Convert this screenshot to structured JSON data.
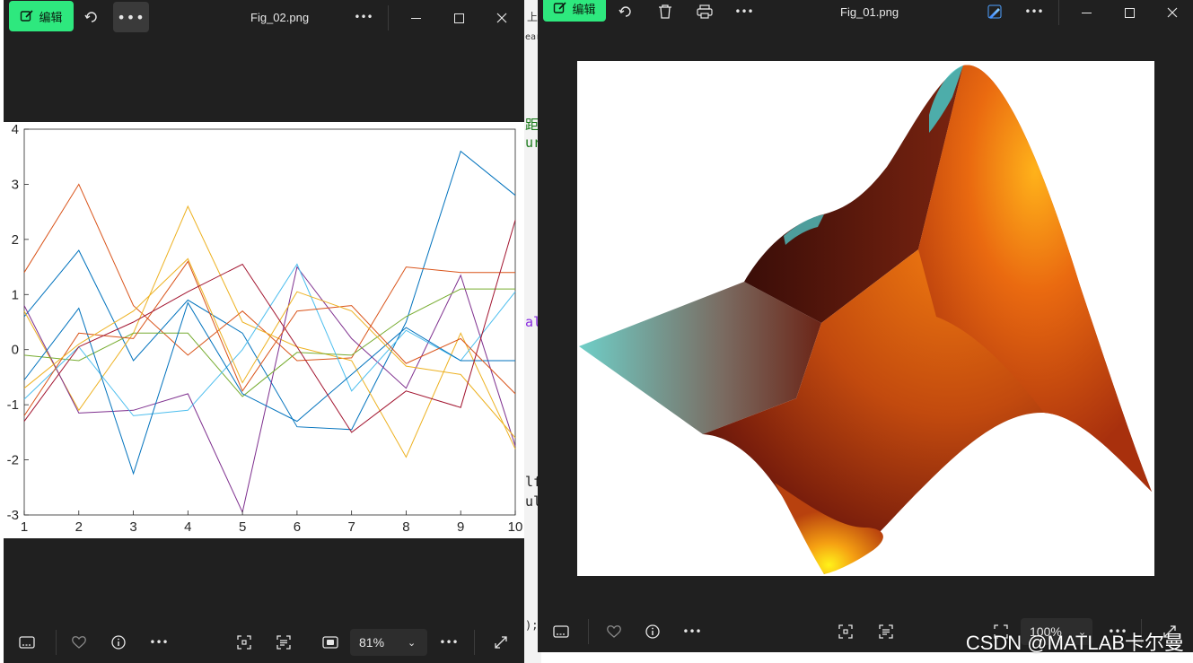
{
  "background_app": {
    "fragments": [
      "上",
      "ear",
      "距",
      "ur",
      "al",
      "lf",
      "ul",
      ");"
    ]
  },
  "left_window": {
    "edit_label": "编辑",
    "title": "Fig_02.png",
    "zoom": "81%",
    "icons": {
      "edit": "edit-icon",
      "rotate": "rotate-icon",
      "more": "more-icon",
      "minimize": "minimize-icon",
      "maximize": "maximize-icon",
      "close": "close-icon",
      "filmstrip": "filmstrip-icon",
      "favorite": "heart-icon",
      "info": "info-icon",
      "crop": "crop-icon",
      "text": "text-recognition-icon",
      "actual_size": "actual-size-icon",
      "fullscreen": "expand-icon"
    }
  },
  "right_window": {
    "edit_label": "编辑",
    "title": "Fig_01.png",
    "zoom": "100%",
    "icons": {
      "edit": "edit-icon",
      "rotate": "rotate-icon",
      "delete": "trash-icon",
      "print": "print-icon",
      "more": "more-icon",
      "ai": "ai-edit-icon"
    }
  },
  "watermark": "CSDN @MATLAB卡尔曼",
  "colors": {
    "matlab_series": [
      "#0072BD",
      "#D95319",
      "#EDB120",
      "#7E2F8E",
      "#77AC30",
      "#4DBEEE",
      "#A2142F"
    ],
    "edit_button": "#2ee87e",
    "window_bg": "#202020"
  },
  "chart_data": {
    "type": "line",
    "x": [
      1,
      2,
      3,
      4,
      5,
      6,
      7,
      8,
      9,
      10
    ],
    "xlim": [
      1,
      10
    ],
    "ylim": [
      -3,
      4
    ],
    "xticks": [
      "1",
      "2",
      "3",
      "4",
      "5",
      "6",
      "7",
      "8",
      "9",
      "10"
    ],
    "yticks": [
      "-3",
      "-2",
      "-1",
      "0",
      "1",
      "2",
      "3",
      "4"
    ],
    "grid": false,
    "series": [
      {
        "color": "#0072BD",
        "values": [
          0.6,
          1.8,
          -0.2,
          0.9,
          0.3,
          -1.4,
          -1.45,
          0.5,
          3.6,
          2.8
        ]
      },
      {
        "color": "#D95319",
        "values": [
          1.4,
          3.0,
          0.8,
          -0.1,
          0.7,
          -0.2,
          -0.15,
          1.5,
          1.4,
          1.4
        ]
      },
      {
        "color": "#EDB120",
        "values": [
          0.7,
          -1.1,
          0.3,
          2.6,
          0.5,
          0.05,
          -0.2,
          -1.95,
          0.3,
          -1.8
        ]
      },
      {
        "color": "#7E2F8E",
        "values": [
          0.8,
          -1.15,
          -1.1,
          -0.8,
          -2.95,
          1.5,
          0.2,
          -0.7,
          1.35,
          -1.75
        ]
      },
      {
        "color": "#77AC30",
        "values": [
          -0.1,
          -0.2,
          0.3,
          0.3,
          -0.85,
          -0.05,
          -0.1,
          0.6,
          1.1,
          1.1
        ]
      },
      {
        "color": "#4DBEEE",
        "values": [
          -0.9,
          0.05,
          -1.2,
          -1.1,
          0.0,
          1.55,
          -0.75,
          0.35,
          -0.2,
          1.05
        ]
      },
      {
        "color": "#0072BD",
        "values": [
          -0.55,
          0.75,
          -2.25,
          0.85,
          -0.8,
          -1.3,
          -0.45,
          0.4,
          -0.2,
          -0.2
        ]
      },
      {
        "color": "#D95319",
        "values": [
          -1.2,
          0.3,
          0.2,
          1.6,
          -0.75,
          0.7,
          0.8,
          -0.25,
          0.2,
          -0.8
        ]
      },
      {
        "color": "#EDB120",
        "values": [
          -0.7,
          0.1,
          0.7,
          1.65,
          -0.6,
          1.05,
          0.7,
          -0.3,
          -0.45,
          -1.6
        ]
      },
      {
        "color": "#A2142F",
        "values": [
          -1.3,
          0.05,
          0.5,
          1.05,
          1.55,
          0.05,
          -1.5,
          -0.75,
          -1.05,
          2.35
        ]
      }
    ]
  }
}
